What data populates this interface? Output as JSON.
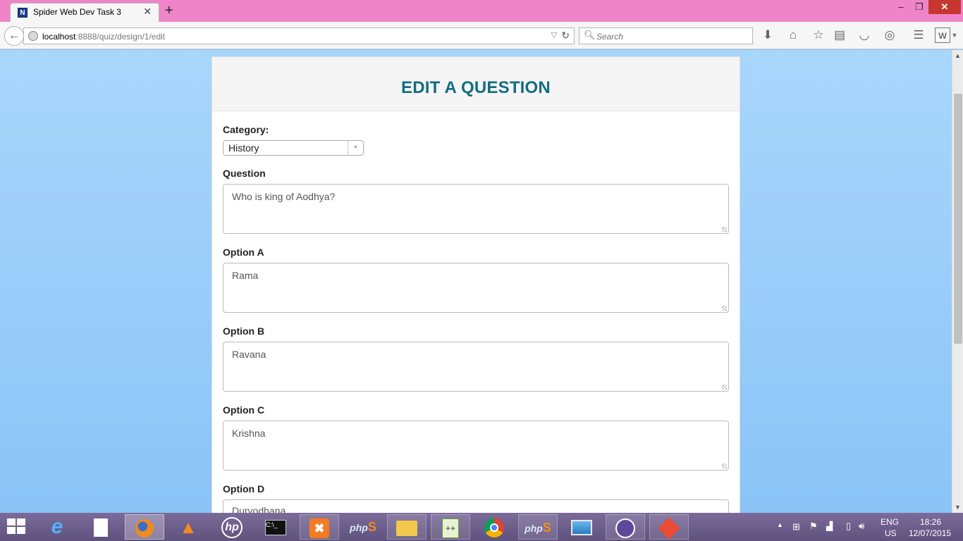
{
  "browser": {
    "tab_title": "Spider Web Dev Task 3",
    "tab_favicon_letter": "N",
    "url_host": "localhost",
    "url_rest": ":8888/quiz/design/1/edit",
    "search_placeholder": "Search",
    "icons": [
      "back-icon",
      "globe-icon",
      "reload-icon",
      "search-icon",
      "download-icon",
      "home-icon",
      "bookmark-star-icon",
      "reading-list-icon",
      "pocket-icon",
      "sync-icon",
      "menu-icon",
      "extension-icon"
    ]
  },
  "page": {
    "title": "EDIT A QUESTION",
    "category_label": "Category:",
    "category_value": "History",
    "question_label": "Question",
    "question_value": "Who is king of Aodhya?",
    "options": [
      {
        "label": "Option A",
        "value": "Rama"
      },
      {
        "label": "Option B",
        "value": "Ravana"
      },
      {
        "label": "Option C",
        "value": "Krishna"
      },
      {
        "label": "Option D",
        "value": "Duryodhana"
      }
    ]
  },
  "taskbar": {
    "apps": [
      "internet-explorer",
      "file",
      "firefox",
      "vlc",
      "hp",
      "command-prompt",
      "xampp",
      "phpstorm",
      "file-explorer",
      "notepad-plus-plus",
      "chrome",
      "phpstorm-2",
      "photos",
      "github",
      "git"
    ],
    "language_line1": "ENG",
    "language_line2": "US",
    "time": "18:26",
    "date": "12/07/2015"
  },
  "colors": {
    "titlebar": "#ef84c8",
    "heading": "#136d81",
    "page_bg": "#a9d6fb",
    "taskbar": "#6d5d8c"
  }
}
